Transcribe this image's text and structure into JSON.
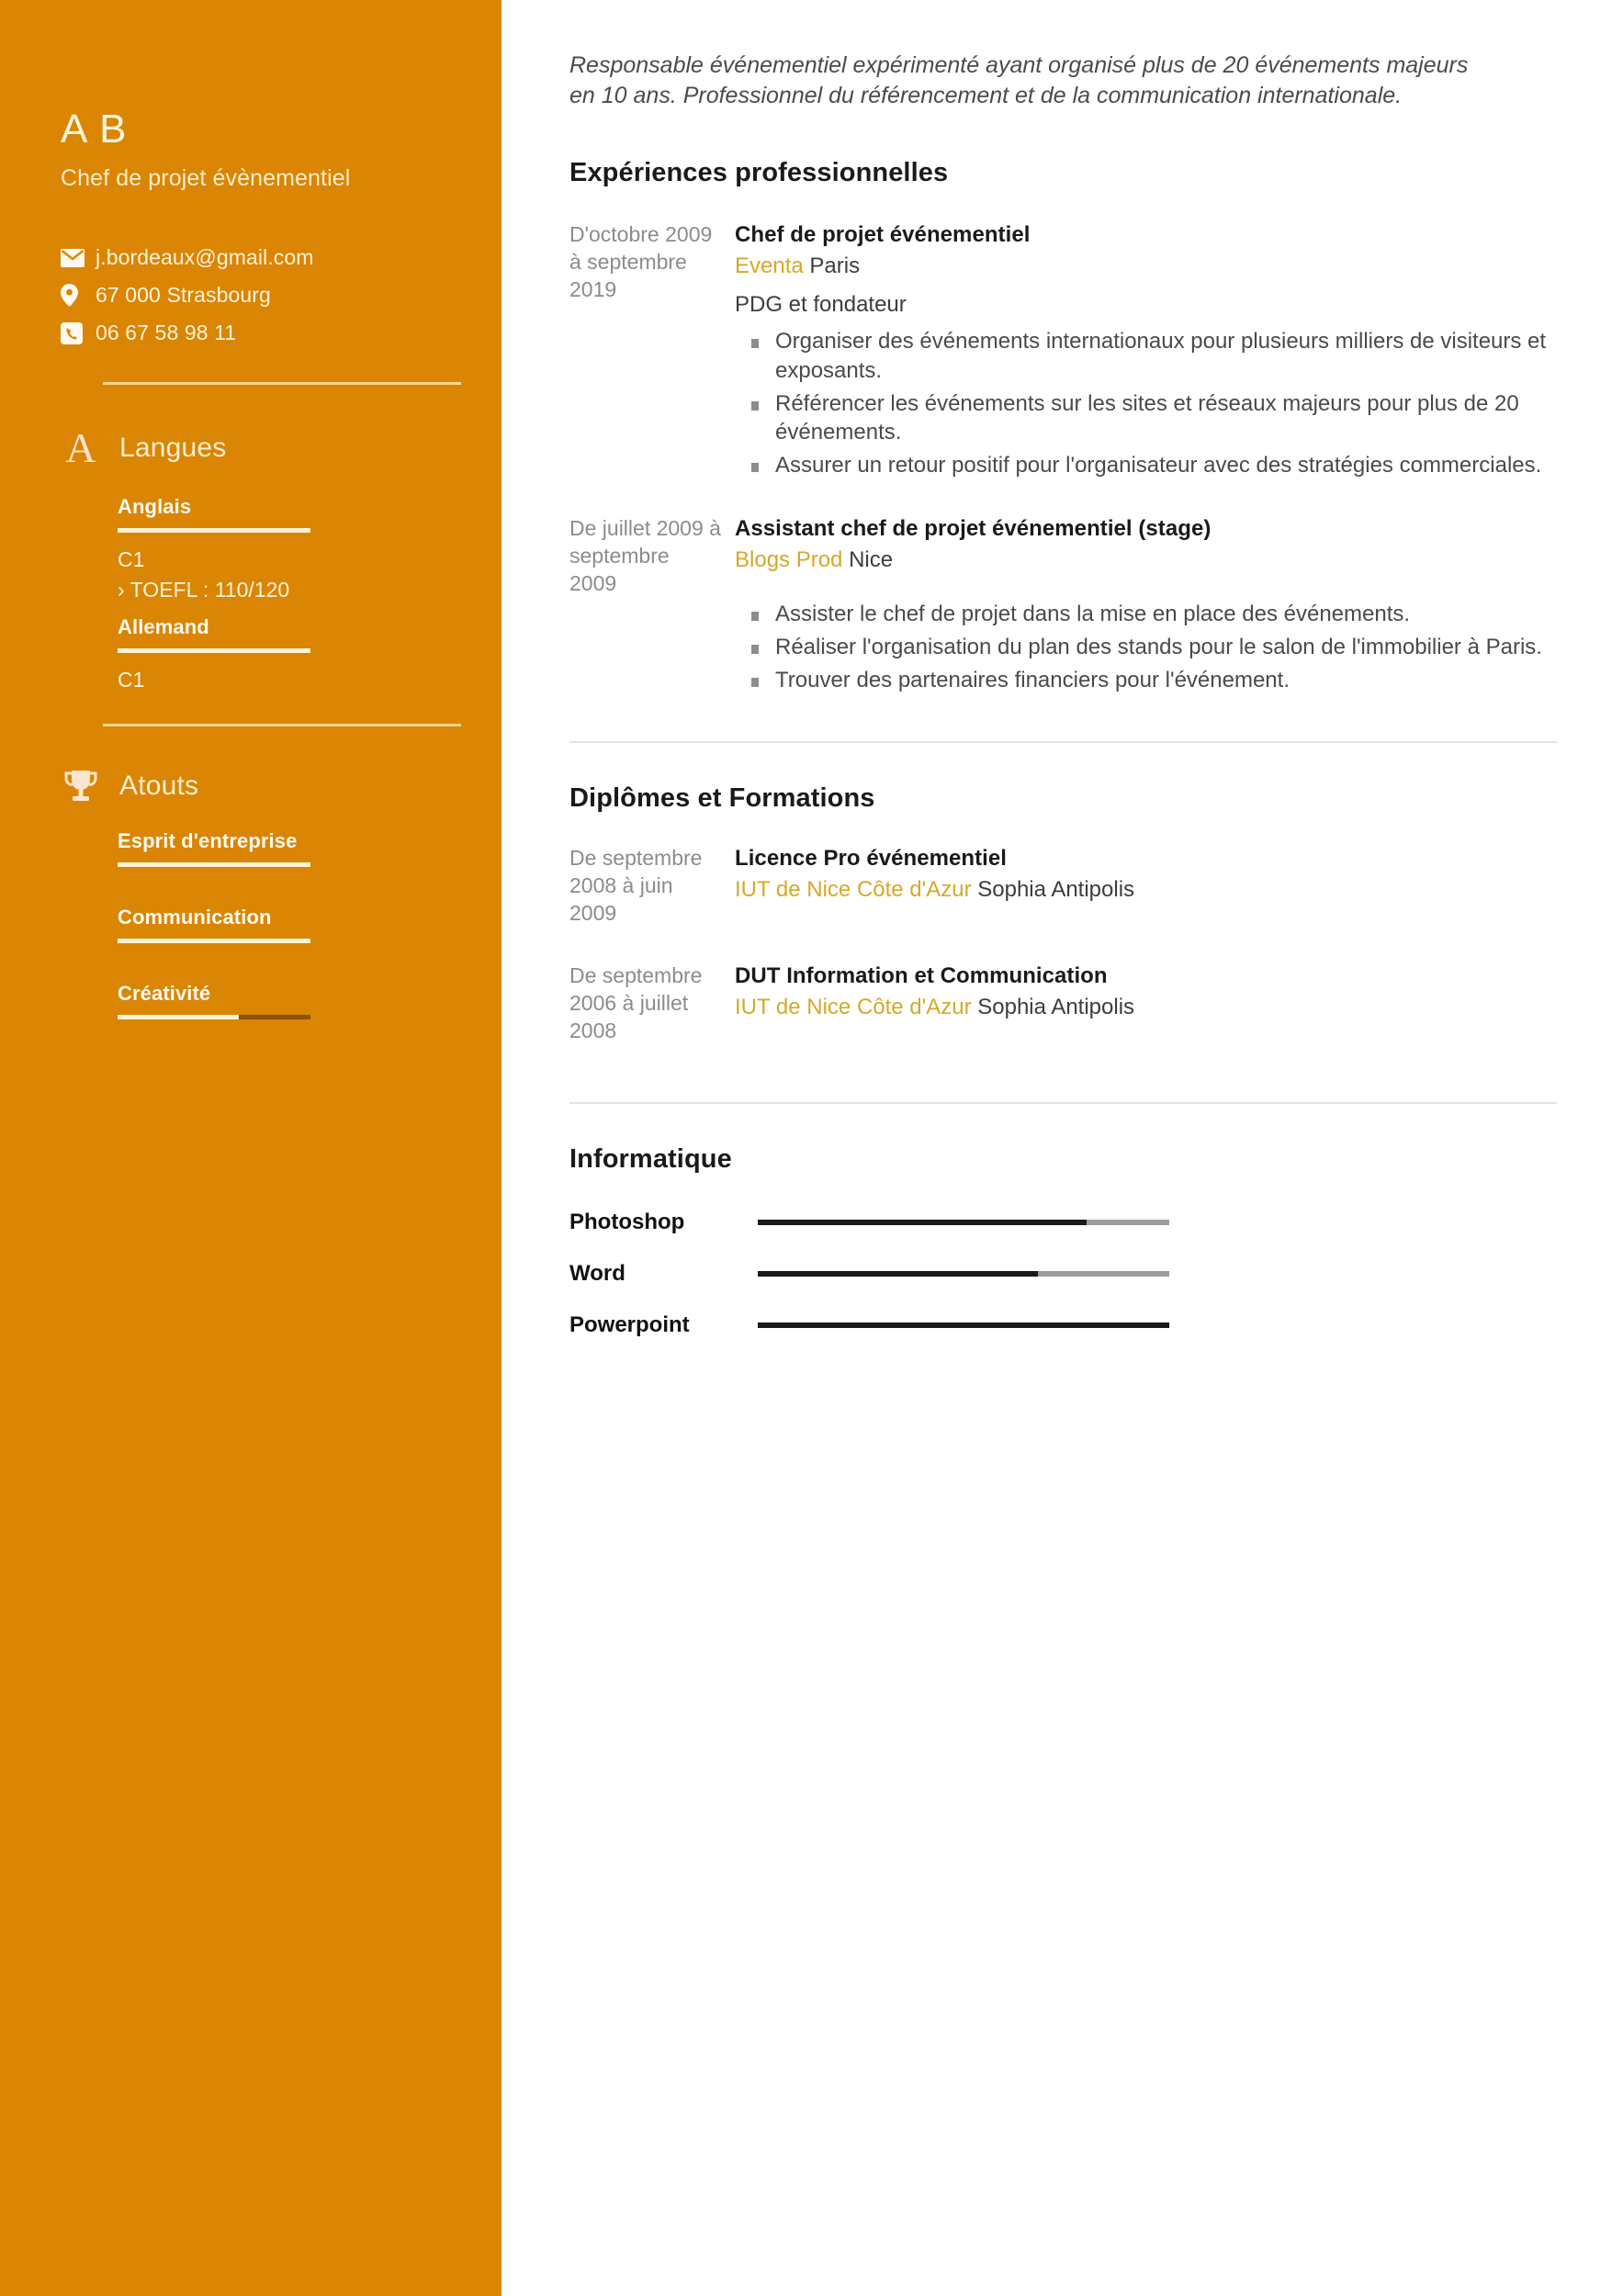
{
  "sidebar": {
    "name": "A B",
    "job_title": "Chef de projet évènementiel",
    "contacts": [
      {
        "icon": "envelope-icon",
        "value": "j.bordeaux@gmail.com"
      },
      {
        "icon": "map-pin-icon",
        "value": "67 000 Strasbourg"
      },
      {
        "icon": "phone-icon",
        "value": "06 67 58 98 11"
      }
    ],
    "languages": {
      "icon": "letter-a-icon",
      "title": "Langues",
      "items": [
        {
          "name": "Anglais",
          "bar_percent": 100,
          "level": "C1",
          "note": "TOEFL : 110/120",
          "note_chevron": "›"
        },
        {
          "name": "Allemand",
          "bar_percent": 100,
          "level": "C1"
        }
      ]
    },
    "strengths": {
      "icon": "trophy-icon",
      "title": "Atouts",
      "items": [
        {
          "name": "Esprit d'entreprise",
          "bar_percent": 100
        },
        {
          "name": "Communication",
          "bar_percent": 100
        },
        {
          "name": "Créativité",
          "bar_percent": 63
        }
      ]
    },
    "colors": {
      "background": "#da8504",
      "text_cream": "#fdf3d8",
      "bar_fill": "#fbf4d8",
      "bar_rest": "#8a5208"
    }
  },
  "main": {
    "summary": "Responsable événementiel expérimenté ayant organisé plus de 20 événements majeurs en 10 ans. Professionnel du référencement et de la communication internationale.",
    "experience": {
      "title": "Expériences professionnelles",
      "entries": [
        {
          "date": "D'octobre 2009 à septembre 2019",
          "role": "Chef de projet événementiel",
          "org": "Eventa",
          "location": "Paris",
          "subtitle": "PDG et fondateur",
          "bullets": [
            "Organiser des événements internationaux pour plusieurs milliers de visiteurs et exposants.",
            "Référencer les événements sur les sites et réseaux majeurs pour plus de 20 événements.",
            "Assurer un retour positif pour l'organisateur avec des stratégies commerciales."
          ]
        },
        {
          "date": "De juillet 2009 à septembre 2009",
          "role": "Assistant chef de projet événementiel (stage)",
          "org": "Blogs Prod",
          "location": "Nice",
          "subtitle": "",
          "bullets": [
            "Assister le chef de projet dans la mise en place des événements.",
            "Réaliser l'organisation du plan des stands pour le salon de l'immobilier à Paris.",
            "Trouver des partenaires financiers pour l'événement."
          ]
        }
      ]
    },
    "education": {
      "title": "Diplômes et Formations",
      "entries": [
        {
          "date": "De septembre 2008 à juin 2009",
          "degree": "Licence Pro événementiel",
          "school": "IUT de Nice Côte d'Azur",
          "campus": "Sophia Antipolis"
        },
        {
          "date": "De septembre 2006 à juillet 2008",
          "degree": "DUT Information et Communication",
          "school": "IUT de Nice Côte d'Azur",
          "campus": "Sophia Antipolis"
        }
      ]
    },
    "computing": {
      "title": "Informatique",
      "items": [
        {
          "label": "Photoshop",
          "percent": 80
        },
        {
          "label": "Word",
          "percent": 68
        },
        {
          "label": "Powerpoint",
          "percent": 100
        }
      ]
    },
    "colors": {
      "accent_gold": "#d6a82a",
      "text_dark": "#1a1a1a",
      "text_body": "#4a4a4a",
      "text_muted": "#8c8c8c",
      "bar_fill": "#1a1a1a",
      "bar_track": "#9c9c9c",
      "rule": "#e2e2e2"
    }
  }
}
